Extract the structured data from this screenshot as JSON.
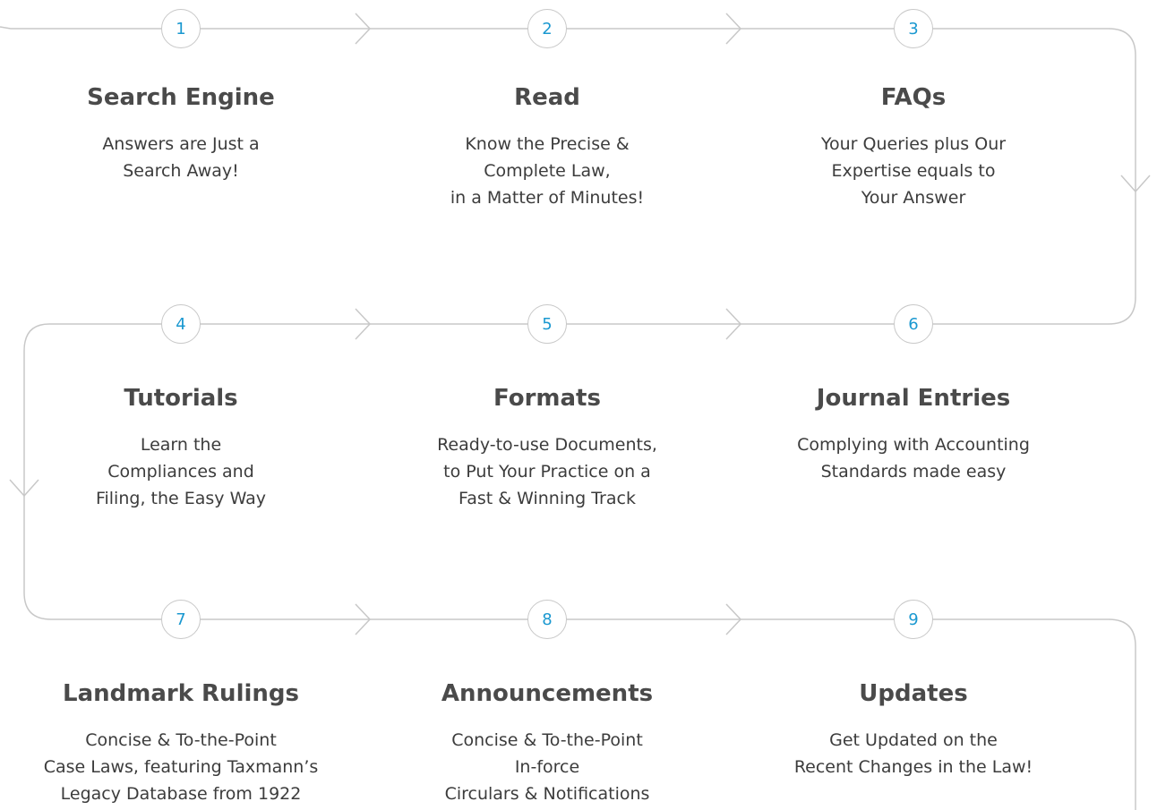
{
  "steps": [
    {
      "number": "1",
      "title": "Search Engine",
      "description": [
        "Answers are Just a",
        "Search Away!"
      ]
    },
    {
      "number": "2",
      "title": "Read",
      "description": [
        "Know the Precise &",
        "Complete Law,",
        "in a Matter of Minutes!"
      ]
    },
    {
      "number": "3",
      "title": "FAQs",
      "description": [
        "Your Queries plus Our",
        "Expertise equals to",
        "Your Answer"
      ]
    },
    {
      "number": "4",
      "title": "Tutorials",
      "description": [
        "Learn the",
        "Compliances and",
        "Filing, the Easy Way"
      ]
    },
    {
      "number": "5",
      "title": "Formats",
      "description": [
        "Ready-to-use Documents,",
        "to Put Your Practice on a",
        "Fast & Winning Track"
      ]
    },
    {
      "number": "6",
      "title": "Journal Entries",
      "description": [
        "Complying with Accounting",
        "Standards made easy"
      ]
    },
    {
      "number": "7",
      "title": "Landmark Rulings",
      "description": [
        "Concise & To-the-Point",
        "Case Laws, featuring Taxmann’s",
        "Legacy Database from 1922"
      ]
    },
    {
      "number": "8",
      "title": "Announcements",
      "description": [
        "Concise & To-the-Point",
        "In-force",
        "Circulars & Notifications"
      ]
    },
    {
      "number": "9",
      "title": "Updates",
      "description": [
        "Get Updated on the",
        "Recent Changes in the Law!"
      ]
    }
  ],
  "colors": {
    "accent": "#1a98d0",
    "line": "#c8c8c8",
    "title": "#4a4a4a",
    "text": "#3c3c3c"
  }
}
